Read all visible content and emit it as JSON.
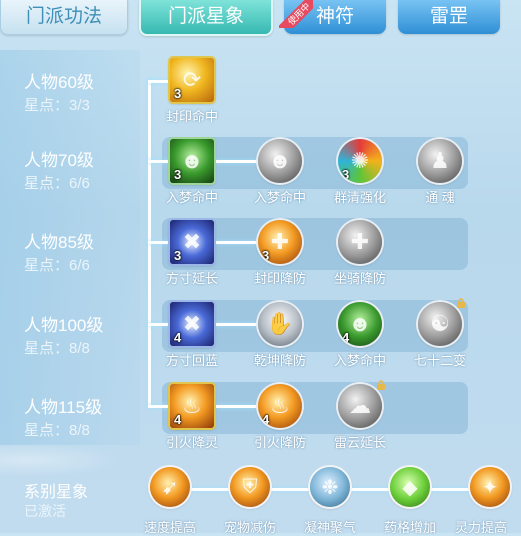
{
  "tabs": [
    {
      "label": "门派功法"
    },
    {
      "label": "门派星象"
    },
    {
      "label": "神符",
      "badge": "使用中"
    },
    {
      "label": "雷罡"
    }
  ],
  "levels": [
    {
      "name": "人物60级",
      "points": "星点：3/3"
    },
    {
      "name": "人物70级",
      "points": "星点：6/6"
    },
    {
      "name": "人物85级",
      "points": "星点：6/6"
    },
    {
      "name": "人物100级",
      "points": "星点：8/8"
    },
    {
      "name": "人物115级",
      "points": "星点：8/8"
    }
  ],
  "skills": [
    {
      "label": "封印命中",
      "level": "3",
      "icon": "golden-swirl-icon"
    },
    {
      "label": "入梦命中",
      "level": "3",
      "icon": "green-spirit-icon"
    },
    {
      "label": "入梦命中",
      "level": "",
      "icon": "grey-spirit-icon"
    },
    {
      "label": "群清强化",
      "level": "3",
      "icon": "rainbow-wheel-icon"
    },
    {
      "label": "通 魂",
      "level": "",
      "icon": "grey-ghost-icon"
    },
    {
      "label": "方寸延长",
      "level": "3",
      "icon": "blue-rune-icon"
    },
    {
      "label": "封印降防",
      "level": "3",
      "icon": "orange-blade-icon"
    },
    {
      "label": "坐骑降防",
      "level": "",
      "icon": "grey-blade-icon"
    },
    {
      "label": "方寸回蓝",
      "level": "4",
      "icon": "blue-rune-icon"
    },
    {
      "label": "乾坤降防",
      "level": "",
      "icon": "grey-hand-icon"
    },
    {
      "label": "入梦命中",
      "level": "4",
      "icon": "green-spirit-icon"
    },
    {
      "label": "七十二变",
      "level": "",
      "icon": "scroll-icon",
      "locked": true
    },
    {
      "label": "引火降灵",
      "level": "4",
      "icon": "flame-icon"
    },
    {
      "label": "引火降防",
      "level": "4",
      "icon": "orange-flame-icon"
    },
    {
      "label": "雷云延长",
      "level": "",
      "icon": "grey-cloud-icon",
      "locked": true
    }
  ],
  "series": {
    "title": "系别星象",
    "status": "已激活",
    "items": [
      {
        "label": "速度提高",
        "icon": "speed-icon"
      },
      {
        "label": "宠物减伤",
        "icon": "pet-shield-icon"
      },
      {
        "label": "凝神聚气",
        "icon": "meditation-icon"
      },
      {
        "label": "药格增加",
        "icon": "herb-gem-icon"
      },
      {
        "label": "灵力提高",
        "icon": "spirit-power-icon"
      }
    ]
  },
  "colors": {
    "accent": "#36b9b2",
    "tab_blue": "#2f8fd5",
    "badge": "#e84a5f",
    "text": "#ffffff"
  }
}
